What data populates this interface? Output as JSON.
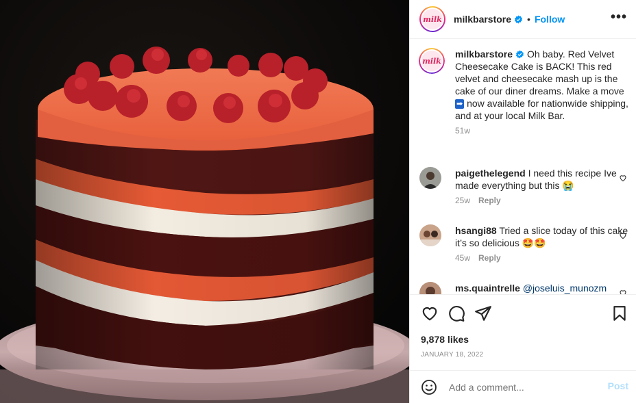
{
  "post": {
    "image_alt": "Red velvet cheesecake layer cake on a glass cake stand",
    "author": "milkbarstore",
    "avatar_text": "milk",
    "follow_label": "Follow",
    "more_label": "•••",
    "caption_author": "milkbarstore",
    "caption_text": "Oh baby. Red Velvet Cheesecake Cake is BACK! This red velvet and cheesecake mash up is the cake of our diner dreams. Make a move",
    "caption_arrow": "➡",
    "caption_text_2": "now available for nationwide shipping, and at your local Milk Bar.",
    "caption_time": "51w"
  },
  "comments": [
    {
      "user": "paigethelegend",
      "text": "I need this recipe Ive made everything but this 😭",
      "time": "25w",
      "reply_label": "Reply"
    },
    {
      "user": "hsangi88",
      "text": "Tried a slice today of this cake it’s so delicious 🤩🤩",
      "time": "45w",
      "reply_label": "Reply"
    },
    {
      "user": "ms.quaintrelle",
      "text": "@joseluis_munozm"
    }
  ],
  "actions": {
    "likes": "9,878 likes",
    "date": "JANUARY 18, 2022",
    "icons": [
      "heart-icon",
      "comment-icon",
      "share-icon",
      "bookmark-icon"
    ]
  },
  "add_comment": {
    "placeholder": "Add a comment...",
    "post_label": "Post"
  },
  "colors": {
    "accent": "#0095f6",
    "post_disabled": "#b2dffc",
    "muted": "#8e8e8e"
  }
}
